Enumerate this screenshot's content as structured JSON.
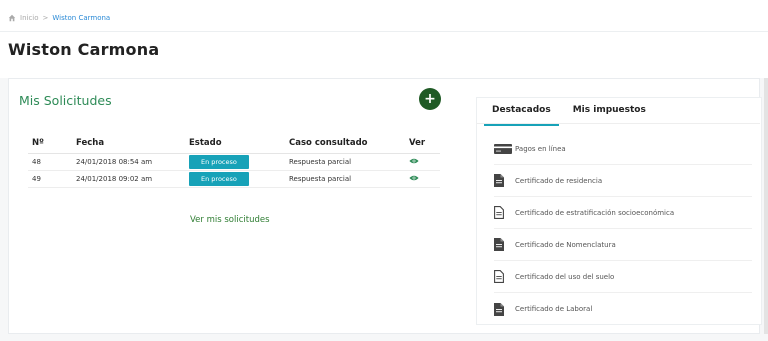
{
  "breadcrumb": {
    "home": "Inicio",
    "separator": ">",
    "current": "Wiston Carmona"
  },
  "page": {
    "title": "Wiston Carmona"
  },
  "requests_card": {
    "title": "Mis Solicitudes",
    "add_label": "+",
    "columns": [
      "Nº",
      "Fecha",
      "Estado",
      "Caso consultado",
      "Ver"
    ],
    "rows": [
      {
        "num": "48",
        "fecha": "24/01/2018 08:54 am",
        "estado": "En proceso",
        "caso": "Respuesta parcial"
      },
      {
        "num": "49",
        "fecha": "24/01/2018 09:02 am",
        "estado": "En proceso",
        "caso": "Respuesta parcial"
      }
    ],
    "view_all": "Ver mis solicitudes"
  },
  "side_card": {
    "tabs": [
      {
        "label": "Destacados",
        "active": true
      },
      {
        "label": "Mis impuestos",
        "active": false
      }
    ],
    "links": [
      {
        "label": "Pagos en línea",
        "icon": "credit-card-icon"
      },
      {
        "label": "Certificado de residencia",
        "icon": "document-filled-icon"
      },
      {
        "label": "Certificado de estratificación socioeconómica",
        "icon": "document-outline-icon"
      },
      {
        "label": "Certificado de Nomenclatura",
        "icon": "document-filled-icon"
      },
      {
        "label": "Certificado del uso del suelo",
        "icon": "document-outline-icon"
      },
      {
        "label": "Certificado de Laboral",
        "icon": "document-filled-icon"
      }
    ]
  },
  "colors": {
    "accent_green": "#2e8b57",
    "add_button": "#1f5a25",
    "badge": "#17a2b8",
    "link_blue": "#2b8ad6"
  }
}
